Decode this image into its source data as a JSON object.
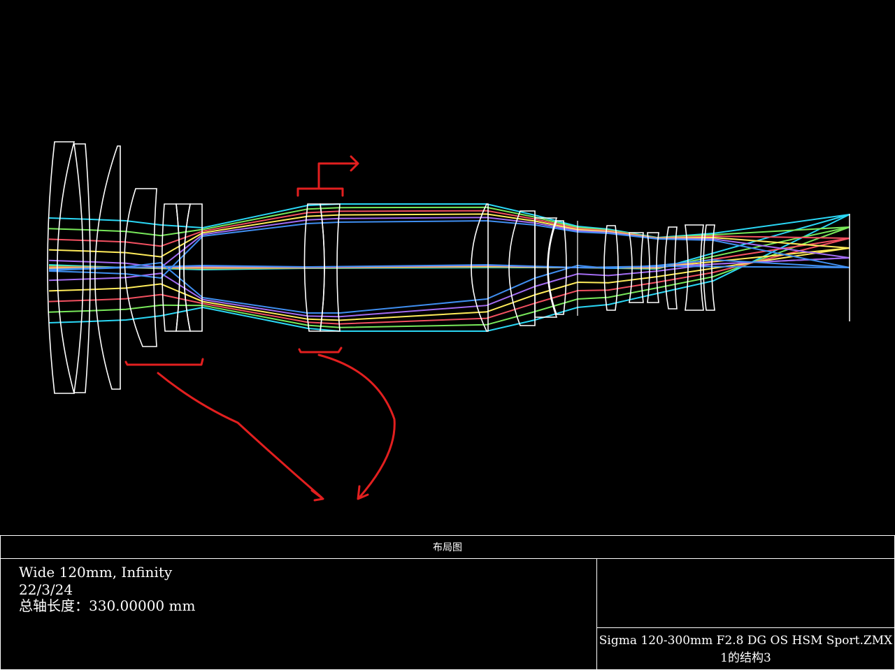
{
  "layout_title": "布局图",
  "info": {
    "config": "Wide 120mm, Infinity",
    "date": "22/3/24",
    "total_length": "总轴长度：330.00000 mm"
  },
  "file": {
    "name": "Sigma 120-300mm F2.8 DG OS HSM Sport.ZMX",
    "configuration": "1的结构3"
  },
  "colors": {
    "background": "#000000",
    "lens": "#ffffff",
    "annotation": "#e21f1f",
    "rays": [
      "#2ad7f5",
      "#78e85a",
      "#f25060",
      "#ffec5a",
      "#a36cf2",
      "#3f8ef0"
    ]
  }
}
